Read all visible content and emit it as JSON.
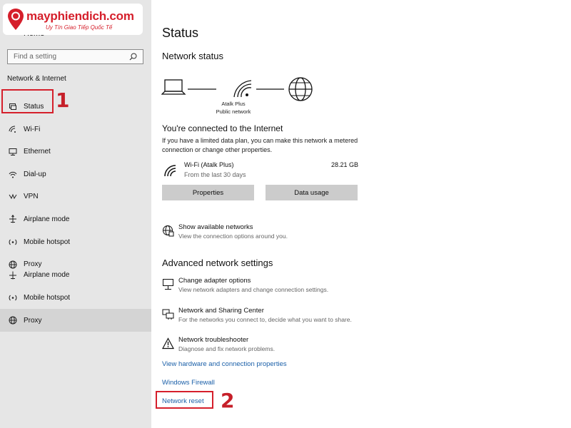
{
  "logo": {
    "brand": "mayphiendich.com",
    "tagline": "Uy Tín Giao Tiếp Quốc Tế"
  },
  "sidebar": {
    "home_label": "Home",
    "search_placeholder": "Find a setting",
    "section_title": "Network & Internet",
    "items": [
      {
        "label": "Status",
        "icon": "status-icon"
      },
      {
        "label": "Wi-Fi",
        "icon": "wifi-icon"
      },
      {
        "label": "Ethernet",
        "icon": "ethernet-icon"
      },
      {
        "label": "Dial-up",
        "icon": "dialup-icon"
      },
      {
        "label": "VPN",
        "icon": "vpn-icon"
      },
      {
        "label": "Airplane mode",
        "icon": "airplane-icon"
      },
      {
        "label": "Mobile hotspot",
        "icon": "hotspot-icon"
      },
      {
        "label": "Proxy",
        "icon": "globe-icon"
      },
      {
        "label": "Airplane mode",
        "icon": "airplane-icon"
      },
      {
        "label": "Mobile hotspot",
        "icon": "hotspot-icon"
      },
      {
        "label": "Proxy",
        "icon": "globe-icon"
      }
    ]
  },
  "annotations": {
    "one": "1",
    "two": "2"
  },
  "main": {
    "title": "Status",
    "network_status_heading": "Network status",
    "diagram": {
      "network_name": "Atalk Plus",
      "network_type": "Public network"
    },
    "connected_heading": "You're connected to the Internet",
    "connected_desc": "If you have a limited data plan, you can make this network a metered connection or change other properties.",
    "wifi": {
      "name": "Wi-Fi (Atalk Plus)",
      "sub": "From the last 30 days",
      "usage": "28.21 GB"
    },
    "properties_button": "Properties",
    "data_usage_button": "Data usage",
    "show_networks": {
      "title": "Show available networks",
      "desc": "View the connection options around you."
    },
    "advanced_heading": "Advanced network settings",
    "change_adapter": {
      "title": "Change adapter options",
      "desc": "View network adapters and change connection settings."
    },
    "sharing_center": {
      "title": "Network and Sharing Center",
      "desc": "For the networks you connect to, decide what you want to share."
    },
    "troubleshooter": {
      "title": "Network troubleshooter",
      "desc": "Diagnose and fix network problems."
    },
    "links": {
      "hardware": "View hardware and connection properties",
      "firewall": "Windows Firewall",
      "reset": "Network reset"
    }
  }
}
